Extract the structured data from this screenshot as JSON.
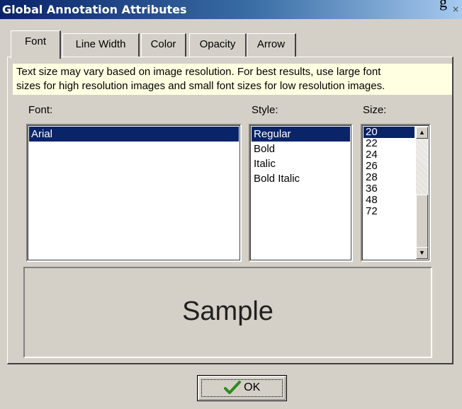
{
  "window": {
    "title": "Global Annotation Attributes",
    "close_glyph": "×",
    "clipped_glyph": "g"
  },
  "tabs": [
    {
      "label": "Font",
      "active": true
    },
    {
      "label": "Line Width",
      "active": false
    },
    {
      "label": "Color",
      "active": false
    },
    {
      "label": "Opacity",
      "active": false
    },
    {
      "label": "Arrow",
      "active": false
    }
  ],
  "info": {
    "line1": "Text size may vary based on image resolution. For best results, use large font",
    "line2": "sizes for high resolution images and small font sizes for low resolution images."
  },
  "font_section": {
    "label": "Font:",
    "items": [
      "Arial"
    ],
    "selected": "Arial"
  },
  "style_section": {
    "label": "Style:",
    "items": [
      "Regular",
      "Bold",
      "Italic",
      "Bold Italic"
    ],
    "selected": "Regular"
  },
  "size_section": {
    "label": "Size:",
    "items": [
      "20",
      "22",
      "24",
      "26",
      "28",
      "36",
      "48",
      "72"
    ],
    "selected": "20"
  },
  "sample": {
    "text": "Sample"
  },
  "ok_button": {
    "label": "OK",
    "icon": "checkmark-icon"
  },
  "colors": {
    "title_bar": "#0a246a",
    "selection": "#0a246a",
    "info_background": "#ffffe1",
    "dialog_face": "#d4d0c8",
    "check_green": "#2e8b1f"
  }
}
